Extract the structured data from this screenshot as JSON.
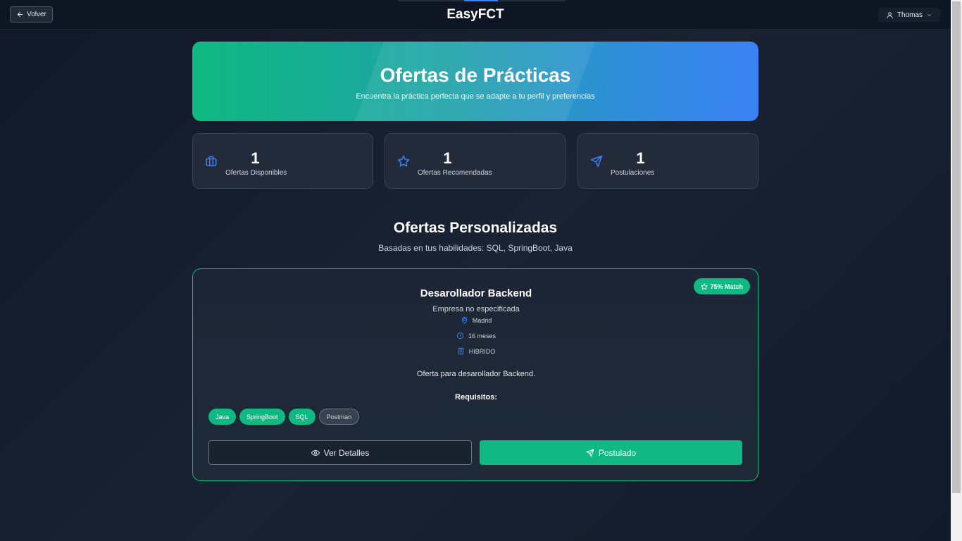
{
  "header": {
    "back_label": "Volver",
    "app_title": "EasyFCT",
    "user_name": "Thomas"
  },
  "hero": {
    "title": "Ofertas de Prácticas",
    "subtitle": "Encuentra la práctica perfecta que se adapte a tu perfil y preferencias"
  },
  "stats": [
    {
      "value": "1",
      "label": "Ofertas Disponibles",
      "icon": "briefcase-icon"
    },
    {
      "value": "1",
      "label": "Ofertas Recomendadas",
      "icon": "star-icon"
    },
    {
      "value": "1",
      "label": "Postulaciones",
      "icon": "send-icon"
    }
  ],
  "section": {
    "title": "Ofertas Personalizadas",
    "subtitle": "Basadas en tus habilidades: SQL, SpringBoot, Java"
  },
  "offer": {
    "match": "75% Match",
    "title": "Desarollador Backend",
    "company": "Empresa no especificada",
    "location": "Madrid",
    "duration": "16 meses",
    "modality": "HIBRIDO",
    "description": "Oferta para desarollador Backend.",
    "requirements_title": "Requisitos:",
    "requirements": [
      {
        "label": "Java",
        "matched": true
      },
      {
        "label": "SpringBoot",
        "matched": true
      },
      {
        "label": "SQL",
        "matched": true
      },
      {
        "label": "Postman",
        "matched": false
      }
    ],
    "details_label": "Ver Detalles",
    "apply_label": "Postulado"
  },
  "colors": {
    "accent_green": "#10b981",
    "accent_blue": "#3b82f6",
    "background": "#111827"
  }
}
